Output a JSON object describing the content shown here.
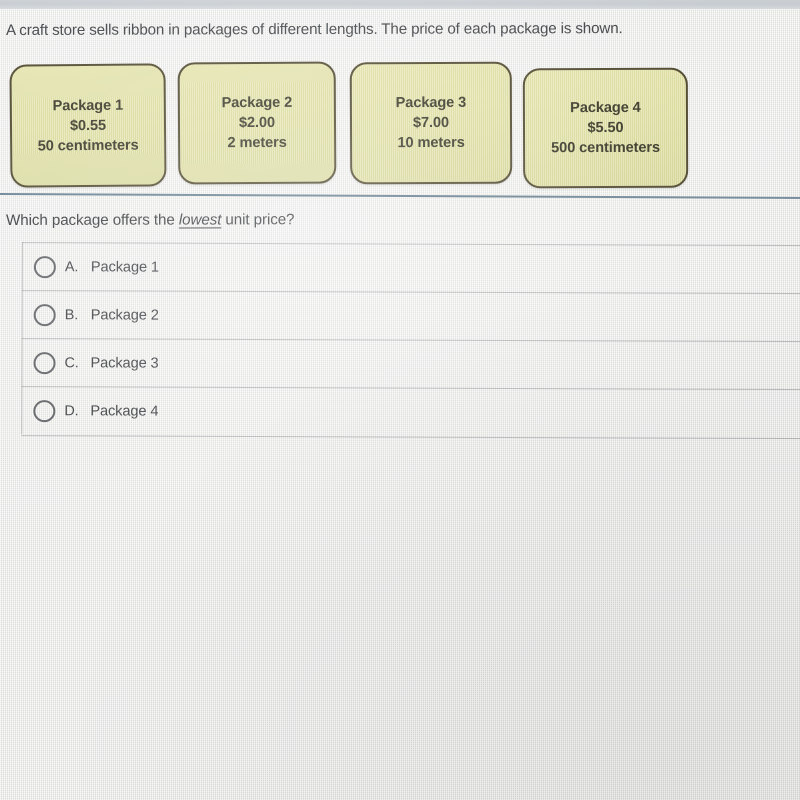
{
  "prompt": "A craft store sells ribbon in packages of different lengths. The price of each package is shown.",
  "packages": [
    {
      "name": "Package 1",
      "price": "$0.55",
      "length": "50 centimeters"
    },
    {
      "name": "Package 2",
      "price": "$2.00",
      "length": "2 meters"
    },
    {
      "name": "Package 3",
      "price": "$7.00",
      "length": "10 meters"
    },
    {
      "name": "Package 4",
      "price": "$5.50",
      "length": "500 centimeters"
    }
  ],
  "question": {
    "before": "Which package offers the ",
    "emphasis": "lowest",
    "after": " unit price?"
  },
  "choices": [
    {
      "letter": "A.",
      "text": "Package 1"
    },
    {
      "letter": "B.",
      "text": "Package 2"
    },
    {
      "letter": "C.",
      "text": "Package 3"
    },
    {
      "letter": "D.",
      "text": "Package 4"
    }
  ],
  "colors": {
    "page_background": "#e9e9e6",
    "card_fill": "#dedf9b",
    "card_border": "#4a4327",
    "rule_blue": "#4f6c80",
    "text": "#3a3e41",
    "top_band": "#c3c9cf"
  }
}
